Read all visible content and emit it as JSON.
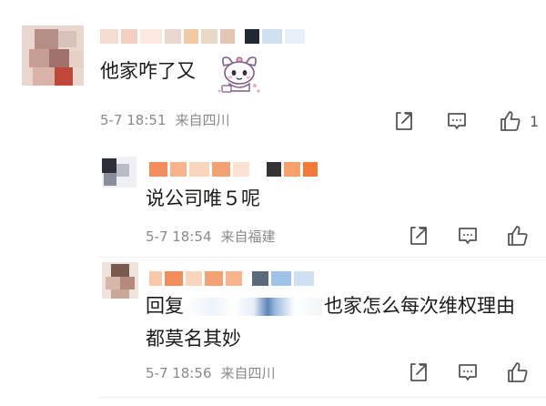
{
  "comments": [
    {
      "text": "他家咋了又",
      "sticker_icon": "kuromi-sticker-icon",
      "date": "5-7 18:51",
      "location": "来自四川",
      "like_count": "1"
    },
    {
      "text": "说公司唯５呢",
      "date": "5-7 18:54",
      "location": "来自福建"
    },
    {
      "reply_prefix": "回复",
      "text_after_redaction": "也家怎么每次维权理由",
      "text_line2": "都莫名其妙",
      "date": "5-7 18:56",
      "location": "来自四川"
    }
  ],
  "icons": {
    "share": "share-icon",
    "comment": "comment-icon",
    "like": "thumbs-up-icon"
  },
  "colors": {
    "text": "#1a1a1a",
    "meta": "#8a8a8a",
    "icon": "#555555"
  }
}
